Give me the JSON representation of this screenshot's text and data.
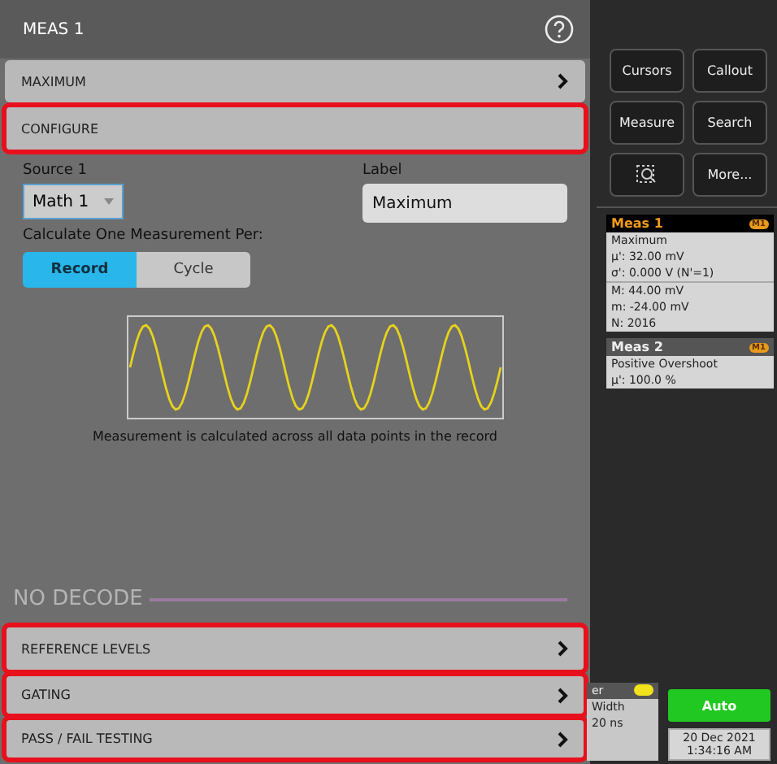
{
  "panel": {
    "title": "MEAS 1",
    "measurement": {
      "label": "MAXIMUM",
      "highlighted": false
    },
    "configure": {
      "label": "CONFIGURE",
      "highlighted": true
    },
    "source": {
      "label": "Source 1",
      "value": "Math 1"
    },
    "name_label": {
      "label": "Label",
      "value": "Maximum"
    },
    "per": {
      "label": "Calculate One Measurement Per:",
      "options": [
        {
          "label": "Record",
          "selected": true
        },
        {
          "label": "Cycle",
          "selected": false
        }
      ]
    },
    "caption": "Measurement is calculated across all data points in the record",
    "decode": "NO DECODE",
    "sections": [
      {
        "label": "REFERENCE LEVELS",
        "highlighted": true
      },
      {
        "label": "GATING",
        "highlighted": true
      },
      {
        "label": "PASS / FAIL TESTING",
        "highlighted": true
      }
    ]
  },
  "side": {
    "buttons": [
      {
        "label": "Cursors",
        "kind": "text"
      },
      {
        "label": "Callout",
        "kind": "text"
      },
      {
        "label": "Measure",
        "kind": "text"
      },
      {
        "label": "Search",
        "kind": "text"
      },
      {
        "kind": "zoom"
      },
      {
        "label": "More...",
        "kind": "text"
      }
    ],
    "cards": [
      {
        "title": "Meas 1",
        "badge": "M1",
        "selected": true,
        "lines": [
          "Maximum",
          "µ': 32.00 mV",
          "σ': 0.000 V (N'=1)",
          "M: 44.00 mV",
          "m: -24.00 mV",
          "N: 2016"
        ]
      },
      {
        "title": "Meas 2",
        "badge": "M1",
        "selected": false,
        "lines": [
          "Positive Overshoot",
          "µ': 100.0 %"
        ]
      }
    ]
  },
  "status": {
    "trigger": {
      "title": "er",
      "lines": [
        "Width",
        "20 ns"
      ]
    },
    "mode": "Auto",
    "date": "20 Dec 2021",
    "time": "1:34:16 AM"
  }
}
